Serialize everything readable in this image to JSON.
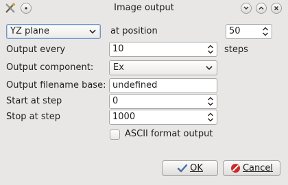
{
  "window": {
    "title": "Image output"
  },
  "plane": {
    "selected": "YZ plane",
    "at_label": "at position",
    "position_value": "50"
  },
  "output_every": {
    "label": "Output every",
    "value": "10",
    "suffix": "steps"
  },
  "component": {
    "label": "Output component:",
    "selected": "Ex"
  },
  "filename": {
    "label": "Output filename base:",
    "value": "undefined"
  },
  "start": {
    "label": "Start at step",
    "value": "0"
  },
  "stop": {
    "label": "Stop at step",
    "value": "1000"
  },
  "ascii": {
    "label": "ASCII format output",
    "checked": false
  },
  "buttons": {
    "ok_label": "OK",
    "cancel_label": "Cancel"
  },
  "icons": {
    "app": "app-icon",
    "menu": "window-menu-icon",
    "help": "help-icon",
    "minimize": "minimize-icon",
    "maximize": "maximize-icon",
    "close": "close-icon",
    "ok": "checkmark-icon",
    "cancel": "cancel-icon"
  }
}
